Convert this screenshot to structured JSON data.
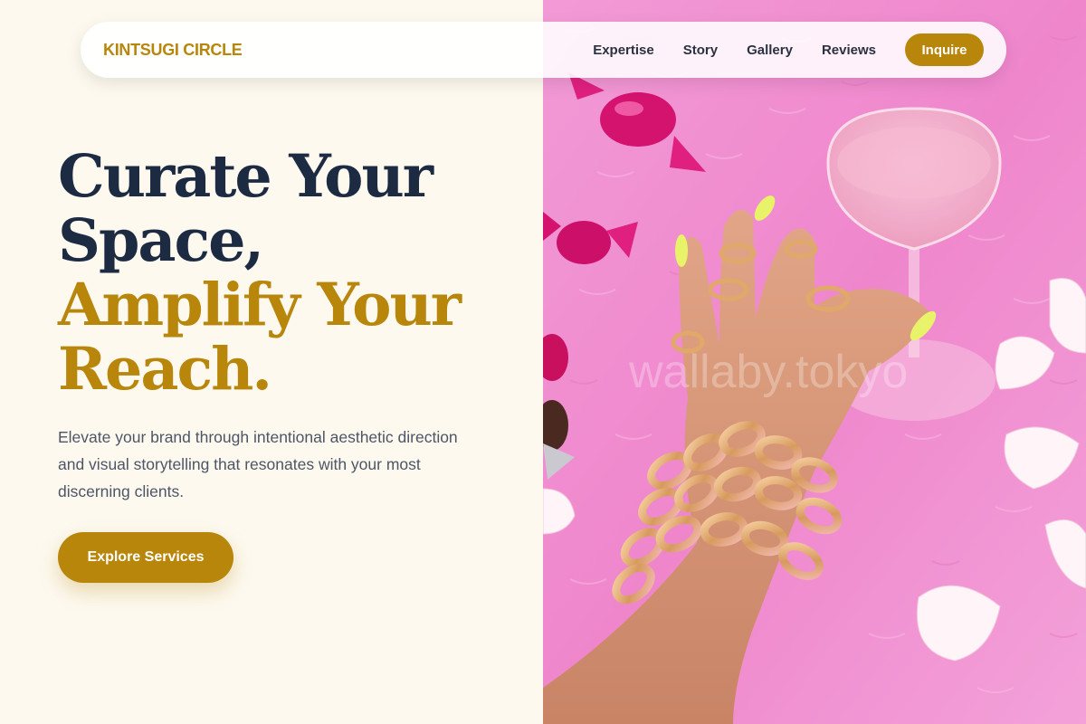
{
  "nav": {
    "brand": "KINTSUGI CIRCLE",
    "links": [
      "Expertise",
      "Story",
      "Gallery",
      "Reviews"
    ],
    "cta_label": "Inquire"
  },
  "hero": {
    "headline_lines": [
      "Curate Your",
      "Space,"
    ],
    "accent_lines": [
      "Amplify Your",
      "Reach."
    ],
    "subcopy": "Elevate your brand through intentional aesthetic direction and visual storytelling that resonates with your most discerning clients.",
    "cta_label": "Explore Services"
  },
  "photo": {
    "watermark": "wallaby.tokyo"
  },
  "colors": {
    "accent": "#b8860b",
    "headline_dark": "#1c2a42",
    "background": "#fdf9ef",
    "photo_pink": "#f08fd0"
  }
}
